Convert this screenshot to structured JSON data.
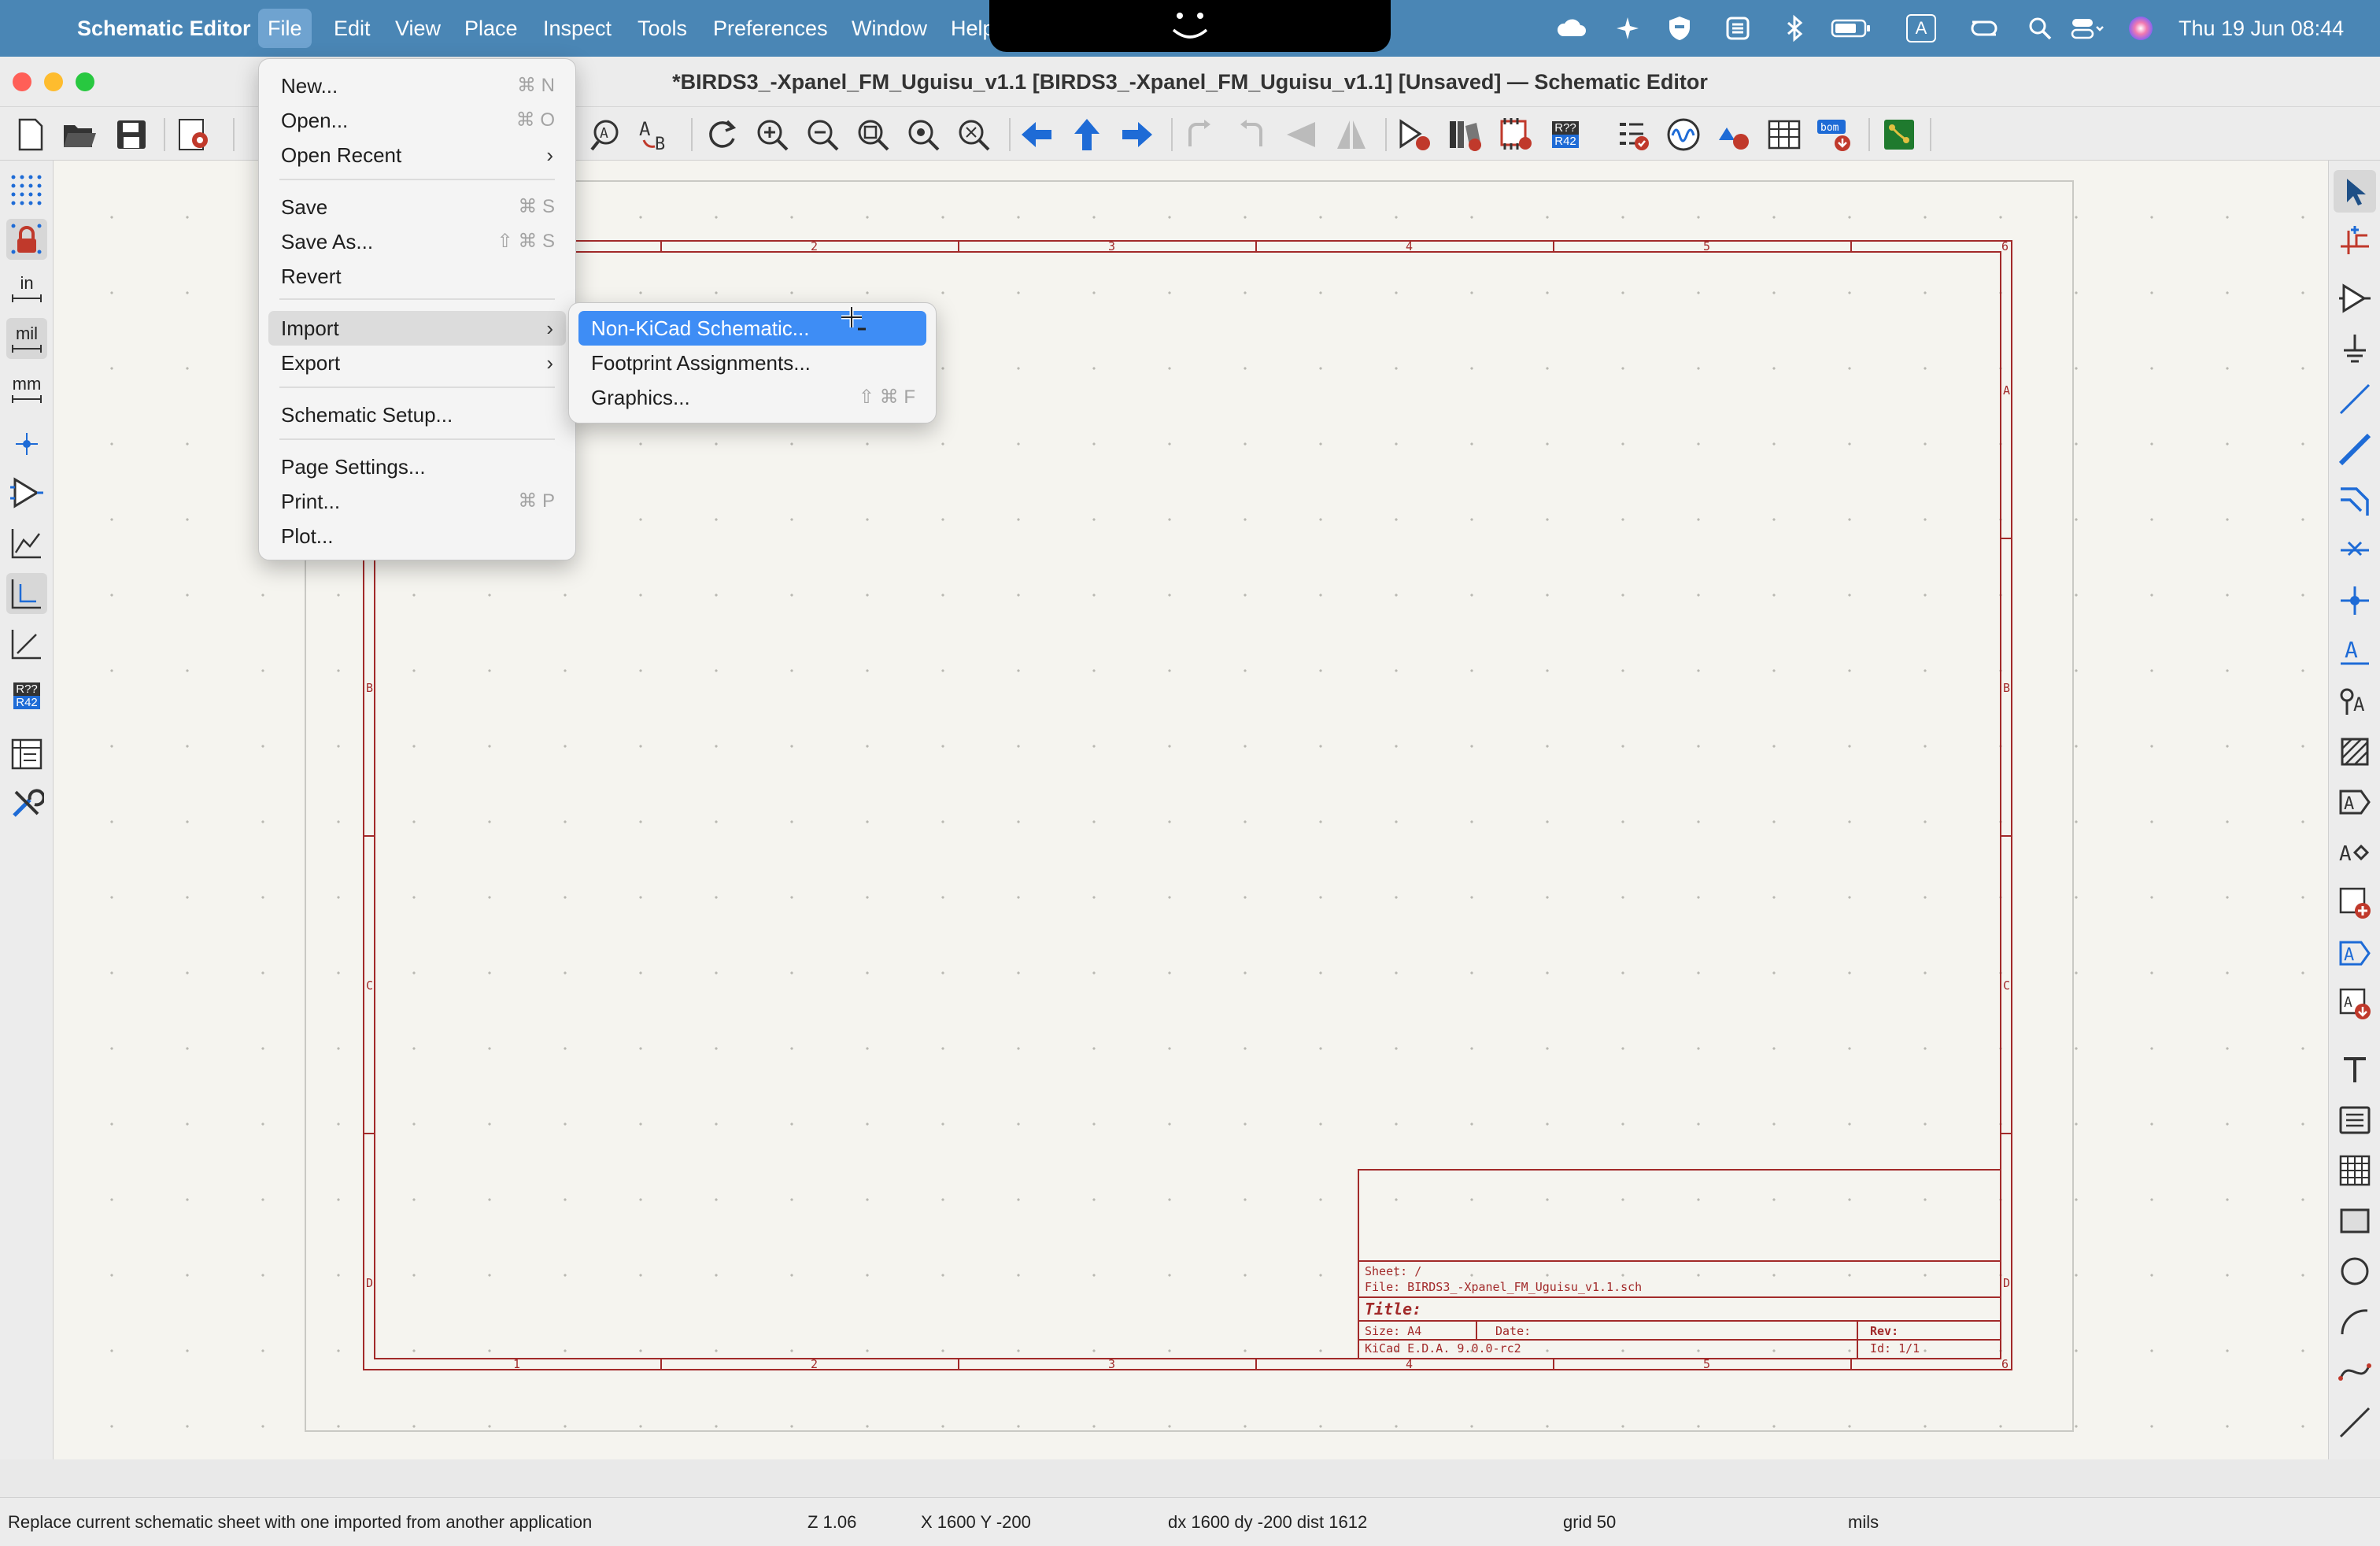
{
  "menubar": {
    "apple_icon": "apple-icon",
    "app_name": "Schematic Editor",
    "items": [
      "File",
      "Edit",
      "View",
      "Place",
      "Inspect",
      "Tools",
      "Preferences",
      "Window",
      "Help"
    ],
    "clock": "Thu 19 Jun  08:44",
    "input_source": "A"
  },
  "window": {
    "title": "*BIRDS3_-Xpanel_FM_Uguisu_v1.1 [BIRDS3_-Xpanel_FM_Uguisu_v1.1] [Unsaved] — Schematic Editor"
  },
  "left_toolbar": {
    "units_in": "in",
    "units_mil": "mil",
    "units_mm": "mm",
    "annotate_top": "R??",
    "annotate_bottom": "R42"
  },
  "top_toolbar": {
    "annotate_top": "R??",
    "annotate_bottom": "R42",
    "bom_label": "bom"
  },
  "file_menu": {
    "items": [
      {
        "label": "New...",
        "shortcut": "⌘ N"
      },
      {
        "label": "Open...",
        "shortcut": "⌘ O"
      },
      {
        "label": "Open Recent",
        "submenu": true
      },
      {
        "label": "Save",
        "shortcut": "⌘ S"
      },
      {
        "label": "Save As...",
        "shortcut": "⇧ ⌘ S"
      },
      {
        "label": "Revert"
      },
      {
        "label": "Import",
        "submenu": true
      },
      {
        "label": "Export",
        "submenu": true
      },
      {
        "label": "Schematic Setup..."
      },
      {
        "label": "Page Settings..."
      },
      {
        "label": "Print...",
        "shortcut": "⌘ P"
      },
      {
        "label": "Plot..."
      }
    ]
  },
  "import_submenu": {
    "items": [
      {
        "label": "Non-KiCad Schematic..."
      },
      {
        "label": "Footprint Assignments..."
      },
      {
        "label": "Graphics...",
        "shortcut": "⇧ ⌘ F"
      }
    ]
  },
  "sheet": {
    "columns_top": [
      "2",
      "3",
      "4",
      "5",
      "6"
    ],
    "columns_bottom": [
      "1",
      "2",
      "3",
      "4",
      "5",
      "6"
    ],
    "rows_left": [
      "B",
      "C",
      "D"
    ],
    "rows_right": [
      "A",
      "B",
      "C",
      "D"
    ],
    "title_block": {
      "sheet": "Sheet: /",
      "file": "File: BIRDS3_-Xpanel_FM_Uguisu_v1.1.sch",
      "title": "Title:",
      "size": "Size: A4",
      "date": "Date:",
      "rev": "Rev:",
      "generator": "KiCad E.D.A. 9.0.0-rc2",
      "id": "Id: 1/1"
    }
  },
  "status": {
    "message": "Replace current schematic sheet with one imported from another application",
    "zoom": "Z 1.06",
    "position": "X 1600  Y -200",
    "delta": "dx 1600  dy -200  dist 1612",
    "grid": "grid 50",
    "units": "mils"
  },
  "colors": {
    "menubar": "#4a86b5",
    "highlight": "#3e8df5",
    "sheet_border": "#a22a2a",
    "canvas": "#f5f4ef"
  }
}
